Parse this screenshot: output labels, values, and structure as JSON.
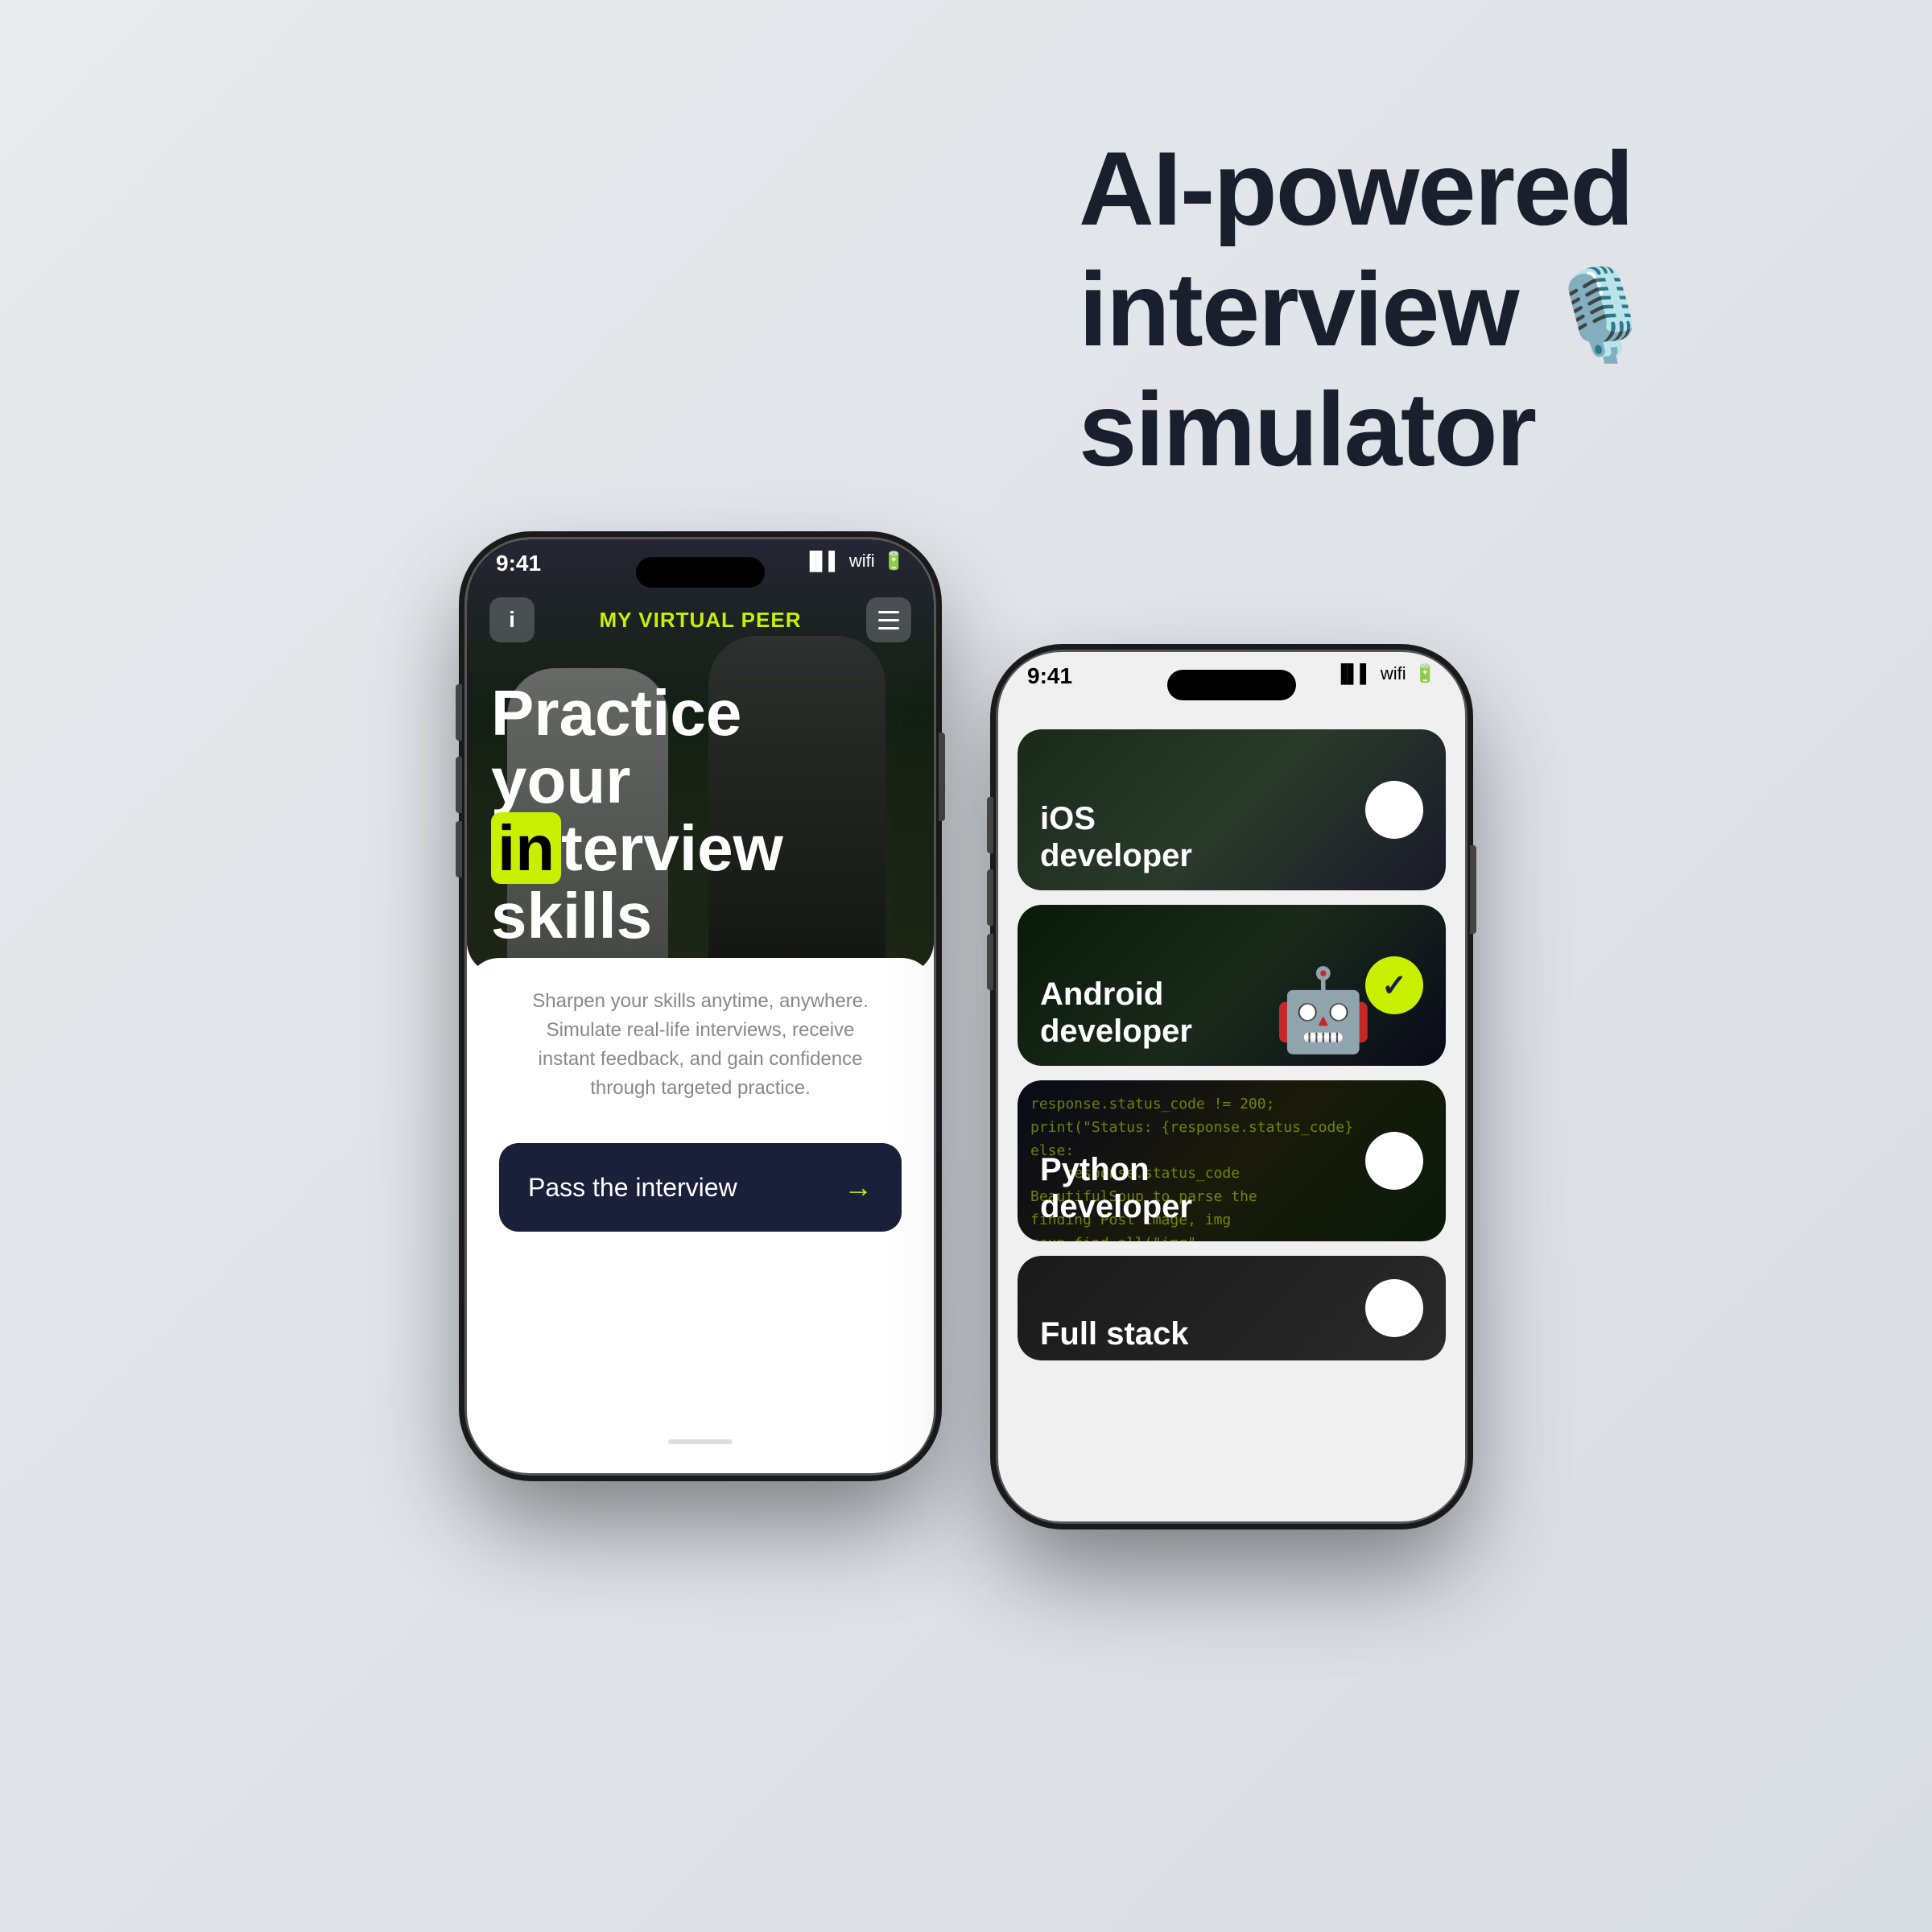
{
  "page": {
    "background": "#e8eaed"
  },
  "headline": {
    "line1": "AI-powered",
    "line2": "interview",
    "line3": "simulator",
    "mic_emoji": "🎙️"
  },
  "phone_left": {
    "status_time": "9:41",
    "nav_logo_my": "MY ",
    "nav_logo_rest": "VIRTUAL PEER",
    "hero_title_line1": "Practice",
    "hero_title_line2": "your",
    "hero_title_highlight": "in",
    "hero_title_after_highlight": "terview",
    "hero_title_line3": "skills",
    "subtitle": "Sharpen your skills anytime, anywhere. Simulate real-life interviews, receive instant feedback, and gain confidence through targeted practice.",
    "cta_label": "Pass the interview",
    "cta_arrow": "→"
  },
  "phone_right": {
    "status_time": "9:41",
    "categories": [
      {
        "id": "ios",
        "label_line1": "iOS",
        "label_line2": "developer",
        "selected": false,
        "icon": "apple"
      },
      {
        "id": "android",
        "label_line1": "Android",
        "label_line2": "developer",
        "selected": true,
        "icon": "android"
      },
      {
        "id": "python",
        "label_line1": "Python",
        "label_line2": "developer",
        "selected": false,
        "icon": "code"
      },
      {
        "id": "fullstack",
        "label_line1": "Full stack",
        "label_line2": "",
        "selected": false,
        "icon": "fullstack"
      }
    ]
  }
}
